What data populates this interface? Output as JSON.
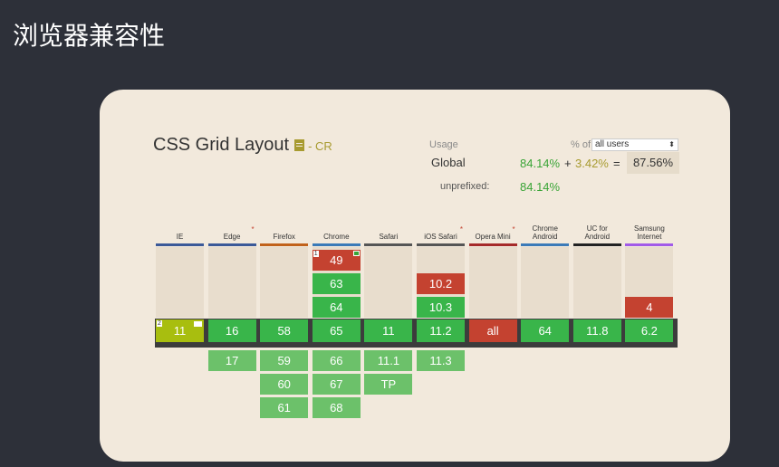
{
  "slide": {
    "title": "浏览器兼容性"
  },
  "feature": {
    "title": "CSS Grid Layout",
    "status": "- CR"
  },
  "usage": {
    "label": "Usage",
    "pct_of": "% of",
    "users_select": "all users",
    "global_label": "Global",
    "supported": "84.14%",
    "plus": "+",
    "partial": "3.42%",
    "equals": "=",
    "total": "87.56%",
    "unprefixed_label": "unprefixed:",
    "unprefixed_value": "84.14%"
  },
  "colors": {
    "supported": "#39b54a",
    "supported_future": "#6cc16a",
    "unsupported": "#c44230",
    "partial": "#a8be0f",
    "card_bg": "#f2e9dc",
    "slide_bg": "#2d3039"
  },
  "browsers": [
    {
      "name": "IE",
      "star": false,
      "bar": "#3b5998",
      "past": [],
      "current": {
        "v": "11",
        "s": "partial",
        "badge": "2",
        "note": true
      },
      "future": []
    },
    {
      "name": "Edge",
      "star": true,
      "bar": "#3b5998",
      "past": [],
      "current": {
        "v": "16",
        "s": "y"
      },
      "future": [
        {
          "v": "17",
          "s": "y"
        }
      ]
    },
    {
      "name": "Firefox",
      "star": false,
      "bar": "#c1621b",
      "past": [],
      "current": {
        "v": "58",
        "s": "y"
      },
      "future": [
        {
          "v": "59",
          "s": "y"
        },
        {
          "v": "60",
          "s": "y"
        },
        {
          "v": "61",
          "s": "y"
        }
      ]
    },
    {
      "name": "Chrome",
      "star": false,
      "bar": "#3b7ab8",
      "past": [
        {
          "v": "49",
          "s": "n",
          "badge": "1",
          "flag": true
        },
        {
          "v": "63",
          "s": "y"
        },
        {
          "v": "64",
          "s": "y"
        }
      ],
      "current": {
        "v": "65",
        "s": "y"
      },
      "future": [
        {
          "v": "66",
          "s": "y"
        },
        {
          "v": "67",
          "s": "y"
        },
        {
          "v": "68",
          "s": "y"
        }
      ]
    },
    {
      "name": "Safari",
      "star": false,
      "bar": "#555555",
      "past": [],
      "current": {
        "v": "11",
        "s": "y"
      },
      "future": [
        {
          "v": "11.1",
          "s": "y"
        },
        {
          "v": "TP",
          "s": "y"
        }
      ]
    },
    {
      "name": "iOS Safari",
      "star": true,
      "bar": "#555555",
      "past": [
        {
          "v": "10.2",
          "s": "n"
        },
        {
          "v": "10.3",
          "s": "y"
        }
      ],
      "current": {
        "v": "11.2",
        "s": "y"
      },
      "future": [
        {
          "v": "11.3",
          "s": "y"
        }
      ]
    },
    {
      "name": "Opera Mini",
      "star": true,
      "bar": "#a52a2a",
      "past": [],
      "current": {
        "v": "all",
        "s": "n"
      },
      "future": []
    },
    {
      "name": "Chrome Android",
      "star": false,
      "bar": "#3b7ab8",
      "past": [],
      "current": {
        "v": "64",
        "s": "y"
      },
      "future": []
    },
    {
      "name": "UC for Android",
      "star": false,
      "bar": "#222222",
      "past": [],
      "current": {
        "v": "11.8",
        "s": "y"
      },
      "future": []
    },
    {
      "name": "Samsung Internet",
      "star": false,
      "bar": "#a25ae8",
      "past": [
        {
          "v": "4",
          "s": "n"
        }
      ],
      "current": {
        "v": "6.2",
        "s": "y"
      },
      "future": []
    }
  ]
}
